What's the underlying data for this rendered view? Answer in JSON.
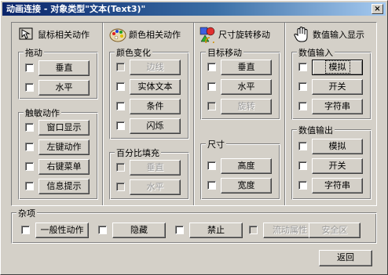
{
  "window": {
    "title": "动画连接 - 对象类型\"文本(Text3)\"",
    "close_label": "×"
  },
  "columns": {
    "mouse": {
      "header": "鼠标相关动作",
      "icon": "mouse-pointer-icon",
      "drag_group": {
        "label": "拖动",
        "items": [
          "垂直",
          "水平"
        ]
      },
      "touch_group": {
        "label": "触敏动作",
        "items": [
          "窗口显示",
          "左键动作",
          "右键菜单",
          "信息提示"
        ]
      }
    },
    "color": {
      "header": "颜色相关动作",
      "icon": "palette-icon",
      "change_group": {
        "label": "颜色变化",
        "items": [
          "边线",
          "实体文本",
          "条件",
          "闪烁"
        ]
      },
      "fill_group": {
        "label": "百分比填充",
        "items": [
          "垂直",
          "水平"
        ]
      }
    },
    "size": {
      "header": "尺寸旋转移动",
      "icon": "shapes-icon",
      "move_group": {
        "label": "目标移动",
        "items": [
          "垂直",
          "水平",
          "旋转"
        ]
      },
      "size_group": {
        "label": "尺寸",
        "items": [
          "高度",
          "宽度"
        ]
      }
    },
    "value": {
      "header": "数值输入显示",
      "icon": "hand-icon",
      "input_group": {
        "label": "数值输入",
        "items": [
          "模拟",
          "开关",
          "字符串"
        ]
      },
      "output_group": {
        "label": "数值输出",
        "items": [
          "模拟",
          "开关",
          "字符串"
        ]
      }
    }
  },
  "misc": {
    "label": "杂项",
    "general": "一般性动作",
    "hide": "隐藏",
    "disable": "禁止",
    "flow": "流动属性",
    "safe_zone": "安全区"
  },
  "footer": {
    "return_label": "返回"
  }
}
